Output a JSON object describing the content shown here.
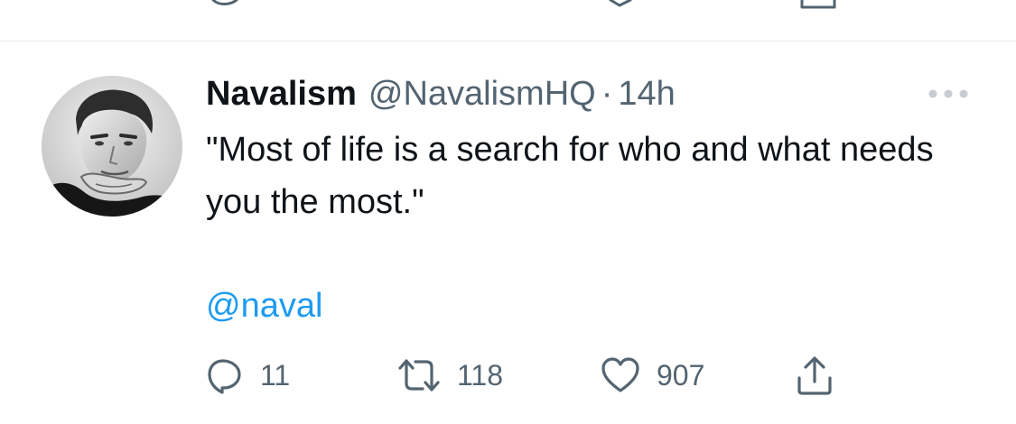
{
  "tweet": {
    "display_name": "Navalism",
    "handle": "@NavalismHQ",
    "separator": "·",
    "time_ago": "14h",
    "text": "\"Most of life is a search for who and what needs you the most.\"",
    "mention": "@naval",
    "avatar_icon": "avatar-photo",
    "more_icon": "more-options-icon"
  },
  "actions": {
    "reply": {
      "icon": "reply-icon",
      "count": "11"
    },
    "retweet": {
      "icon": "retweet-icon",
      "count": "118"
    },
    "like": {
      "icon": "heart-icon",
      "count": "907"
    },
    "share": {
      "icon": "share-icon"
    }
  },
  "colors": {
    "text_primary": "#0f1419",
    "text_secondary": "#536471",
    "link": "#1d9bf0",
    "divider": "#e6ecf0",
    "background": "#ffffff"
  }
}
